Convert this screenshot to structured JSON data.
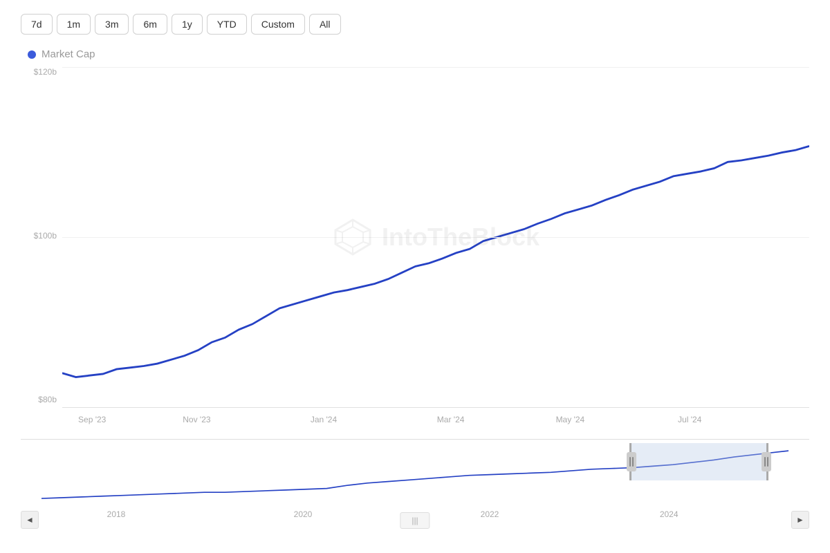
{
  "filters": {
    "buttons": [
      "7d",
      "1m",
      "3m",
      "6m",
      "1y",
      "YTD",
      "Custom",
      "All"
    ]
  },
  "legend": {
    "label": "Market Cap",
    "color": "#3b5bdb"
  },
  "yAxis": {
    "labels": [
      "$120b",
      "$100b",
      "$80b"
    ]
  },
  "xAxis": {
    "labels": [
      {
        "text": "Sep '23",
        "pct": 4
      },
      {
        "text": "Nov '23",
        "pct": 18
      },
      {
        "text": "Jan '24",
        "pct": 35
      },
      {
        "text": "Mar '24",
        "pct": 52
      },
      {
        "text": "May '24",
        "pct": 68
      },
      {
        "text": "Jul '24",
        "pct": 84
      }
    ]
  },
  "navigator": {
    "xLabels": [
      {
        "text": "2018",
        "pct": 10
      },
      {
        "text": "2020",
        "pct": 35
      },
      {
        "text": "2022",
        "pct": 60
      },
      {
        "text": "2024",
        "pct": 84
      }
    ],
    "selectionStart": 79,
    "selectionEnd": 97,
    "scrollLeft": "◄",
    "scrollRight": "►",
    "scrollCenter": "|||"
  },
  "watermark": {
    "text": "IntoTheBlock"
  }
}
